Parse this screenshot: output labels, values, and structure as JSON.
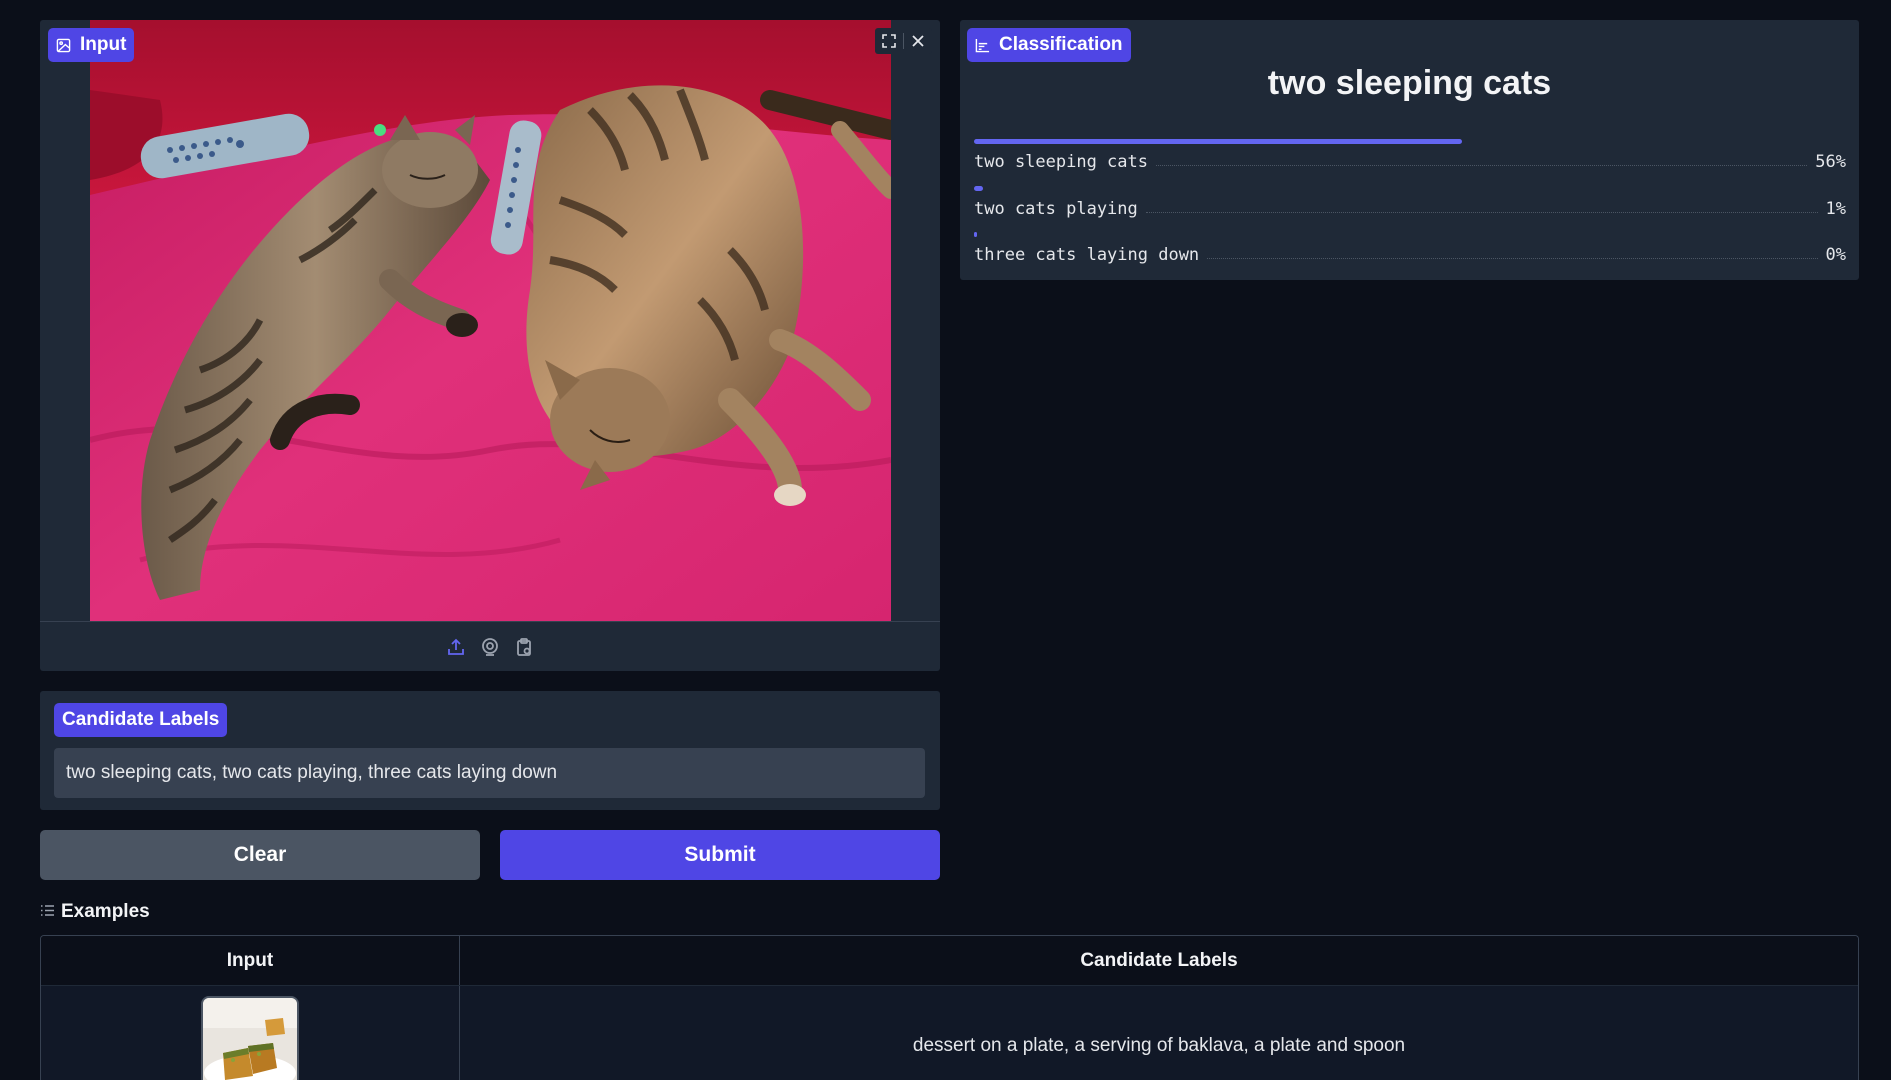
{
  "input_panel": {
    "label": "Input",
    "icon": "image-icon",
    "toolbar_icons": [
      "fullscreen-icon",
      "close-icon"
    ],
    "source_icons": [
      "upload-icon",
      "webcam-icon",
      "clipboard-icon"
    ]
  },
  "classification": {
    "label": "Classification",
    "icon": "bar-chart-icon",
    "top_label": "two sleeping cats",
    "confidences": [
      {
        "label": "two sleeping cats",
        "value": 0.56,
        "display": "56%"
      },
      {
        "label": "two cats playing",
        "value": 0.01,
        "display": "1%"
      },
      {
        "label": "three cats laying down",
        "value": 0.0,
        "display": "0%"
      }
    ]
  },
  "candidate_labels": {
    "label": "Candidate Labels",
    "value": "two sleeping cats, two cats playing, three cats laying down"
  },
  "buttons": {
    "clear": "Clear",
    "submit": "Submit"
  },
  "examples": {
    "title": "Examples",
    "icon": "list-icon",
    "headers": [
      "Input",
      "Candidate Labels"
    ],
    "rows": [
      {
        "labels": "dessert on a plate, a serving of baklava, a plate and spoon"
      }
    ]
  },
  "colors": {
    "accent": "#4f46e5",
    "background": "#0b0f19",
    "panel": "#1f2937"
  }
}
